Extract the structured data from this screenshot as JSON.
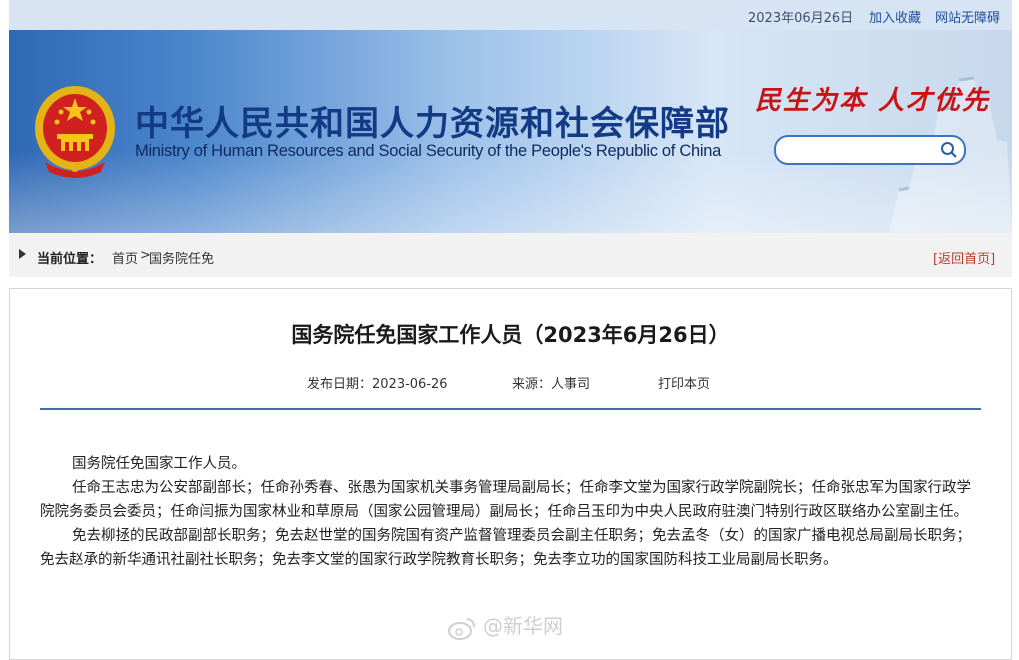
{
  "topbar": {
    "date": "2023年06月26日",
    "favorite": "加入收藏",
    "accessibility": "网站无障碍"
  },
  "header": {
    "title_cn": "中华人民共和国人力资源和社会保障部",
    "title_en": "Ministry of Human Resources and Social Security of the People's Republic of China",
    "slogan": "民生为本 人才优先",
    "search_placeholder": "",
    "colors": {
      "title": "#123a85",
      "slogan": "#c81414",
      "banner": "#4b86cc"
    }
  },
  "breadcrumb": {
    "label": "当前位置：",
    "home": "首页",
    "separator": ">",
    "current": "国务院任免",
    "back_home": "[返回首页]"
  },
  "article": {
    "title": "国务院任免国家工作人员（2023年6月26日）",
    "date_label": "发布日期：2023-06-26",
    "source_label": "来源：人事司",
    "print_label": "打印本页",
    "paragraphs": [
      "国务院任免国家工作人员。",
      "任命王志忠为公安部副部长；任命孙秀春、张愚为国家机关事务管理局副局长；任命李文堂为国家行政学院副院长；任命张忠军为国家行政学院院务委员会委员；任命闫振为国家林业和草原局（国家公园管理局）副局长；任命吕玉印为中央人民政府驻澳门特别行政区联络办公室副主任。",
      "免去柳拯的民政部副部长职务；免去赵世堂的国务院国有资产监督管理委员会副主任职务；免去孟冬（女）的国家广播电视总局副局长职务；免去赵承的新华通讯社副社长职务；免去李文堂的国家行政学院教育长职务；免去李立功的国家国防科技工业局副局长职务。"
    ],
    "watermark": "@新华网"
  }
}
